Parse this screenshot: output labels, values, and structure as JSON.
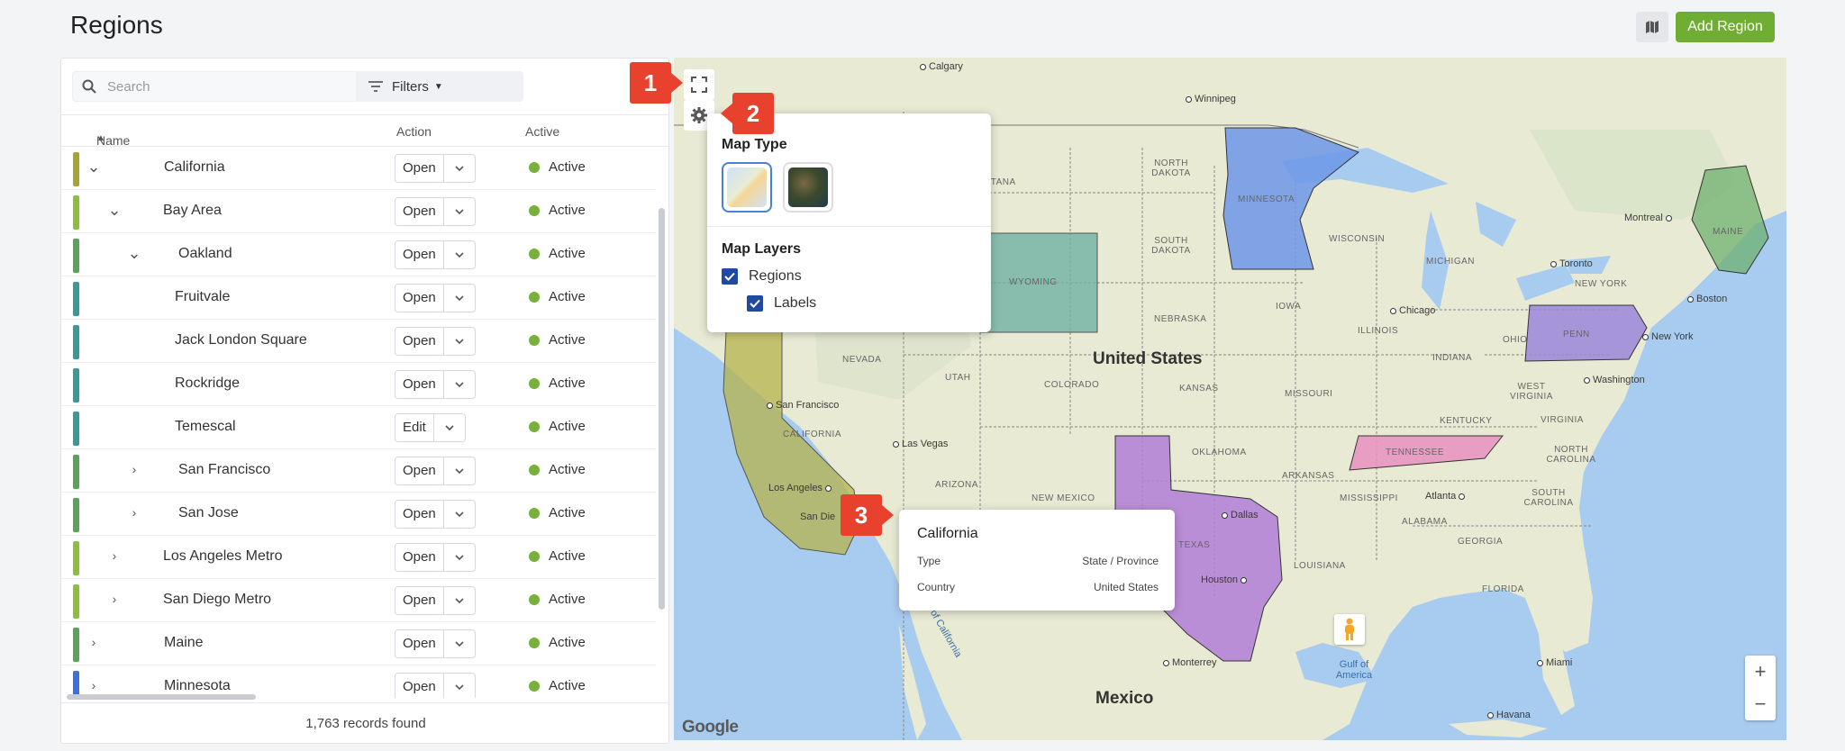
{
  "header": {
    "title": "Regions",
    "add_label": "Add Region",
    "map_icon": "map-icon"
  },
  "toolbar": {
    "search_placeholder": "Search",
    "filters_label": "Filters"
  },
  "table": {
    "columns": {
      "name": "Name",
      "action": "Action",
      "active": "Active"
    },
    "rows": [
      {
        "name": "California",
        "action": "Open",
        "status": "Active",
        "color": "#a5a536",
        "depth": 0,
        "expand": "expanded"
      },
      {
        "name": "Bay Area",
        "action": "Open",
        "status": "Active",
        "color": "#8cbf3f",
        "depth": 1,
        "expand": "expanded"
      },
      {
        "name": "Oakland",
        "action": "Open",
        "status": "Active",
        "color": "#5aa35a",
        "depth": 2,
        "expand": "expanded"
      },
      {
        "name": "Fruitvale",
        "action": "Open",
        "status": "Active",
        "color": "#3a9999",
        "depth": 3,
        "expand": "none"
      },
      {
        "name": "Jack London Square",
        "action": "Open",
        "status": "Active",
        "color": "#3a9999",
        "depth": 3,
        "expand": "none"
      },
      {
        "name": "Rockridge",
        "action": "Open",
        "status": "Active",
        "color": "#3a9999",
        "depth": 3,
        "expand": "none"
      },
      {
        "name": "Temescal",
        "action": "Edit",
        "status": "Active",
        "color": "#3a9999",
        "depth": 3,
        "expand": "none"
      },
      {
        "name": "San Francisco",
        "action": "Open",
        "status": "Active",
        "color": "#5aa35a",
        "depth": 2,
        "expand": "collapsed"
      },
      {
        "name": "San Jose",
        "action": "Open",
        "status": "Active",
        "color": "#5aa35a",
        "depth": 2,
        "expand": "collapsed"
      },
      {
        "name": "Los Angeles Metro",
        "action": "Open",
        "status": "Active",
        "color": "#8cbf3f",
        "depth": 1,
        "expand": "collapsed"
      },
      {
        "name": "San Diego Metro",
        "action": "Open",
        "status": "Active",
        "color": "#8cbf3f",
        "depth": 1,
        "expand": "collapsed"
      },
      {
        "name": "Maine",
        "action": "Open",
        "status": "Active",
        "color": "#5aa35a",
        "depth": 0,
        "expand": "collapsed"
      },
      {
        "name": "Minnesota",
        "action": "Open",
        "status": "Active",
        "color": "#3d6fe0",
        "depth": 0,
        "expand": "collapsed"
      }
    ],
    "footer": "1,763 records found"
  },
  "settings": {
    "map_type_title": "Map Type",
    "map_layers_title": "Map Layers",
    "layer_regions": "Regions",
    "layer_labels": "Labels"
  },
  "tooltip": {
    "title": "California",
    "type_label": "Type",
    "type_value": "State / Province",
    "country_label": "Country",
    "country_value": "United States"
  },
  "callouts": [
    "1",
    "2",
    "3"
  ],
  "map": {
    "country_main": "United States",
    "country_south": "Mexico",
    "cities": [
      "Calgary",
      "Winnipeg",
      "Montreal",
      "Toronto",
      "Boston",
      "New York",
      "Chicago",
      "Washington",
      "Las Vegas",
      "San Francisco",
      "Los Angeles",
      "San Die",
      "Atlanta",
      "Dallas",
      "Houston",
      "Monterrey",
      "Miami",
      "Havana"
    ],
    "states": [
      "NORTH DAKOTA",
      "SOUTH DAKOTA",
      "MINNESOTA",
      "WISCONSIN",
      "MICHIGAN",
      "NEBRASKA",
      "IOWA",
      "ILLINOIS",
      "INDIANA",
      "OHIO",
      "PENN",
      "NEW YORK",
      "MAINE",
      "WYOMING",
      "NEVADA",
      "UTAH",
      "COLORADO",
      "KANSAS",
      "MISSOURI",
      "KENTUCKY",
      "WEST VIRGINIA",
      "VIRGINIA",
      "TENNESSEE",
      "NORTH CAROLINA",
      "SOUTH CAROLINA",
      "OKLAHOMA",
      "ARKANSAS",
      "ARIZONA",
      "NEW MEXICO",
      "MISSISSIPPI",
      "ALABAMA",
      "GEORGIA",
      "LOUISIANA",
      "FLORIDA",
      "CALIFORNIA",
      "TEXAS",
      "NTANA"
    ],
    "water": [
      "Gulf of America",
      "lf of California"
    ],
    "attribution": "Google"
  }
}
